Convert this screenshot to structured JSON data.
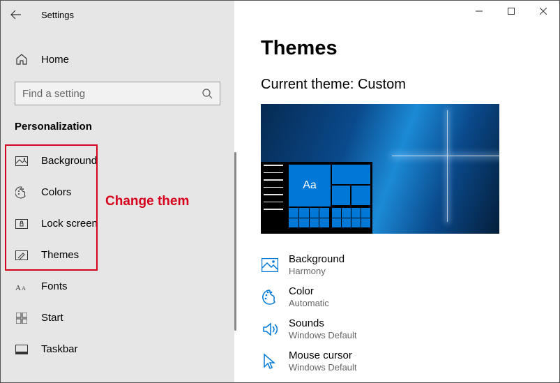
{
  "window_title": "Settings",
  "home_label": "Home",
  "search_placeholder": "Find a setting",
  "section": "Personalization",
  "nav": [
    {
      "label": "Background"
    },
    {
      "label": "Colors"
    },
    {
      "label": "Lock screen"
    },
    {
      "label": "Themes"
    },
    {
      "label": "Fonts"
    },
    {
      "label": "Start"
    },
    {
      "label": "Taskbar"
    }
  ],
  "annotation": "Change them",
  "page_title": "Themes",
  "current_theme_label": "Current theme: Custom",
  "preview_tile_text": "Aa",
  "settings": [
    {
      "label": "Background",
      "value": "Harmony"
    },
    {
      "label": "Color",
      "value": "Automatic"
    },
    {
      "label": "Sounds",
      "value": "Windows Default"
    },
    {
      "label": "Mouse cursor",
      "value": "Windows Default"
    }
  ]
}
